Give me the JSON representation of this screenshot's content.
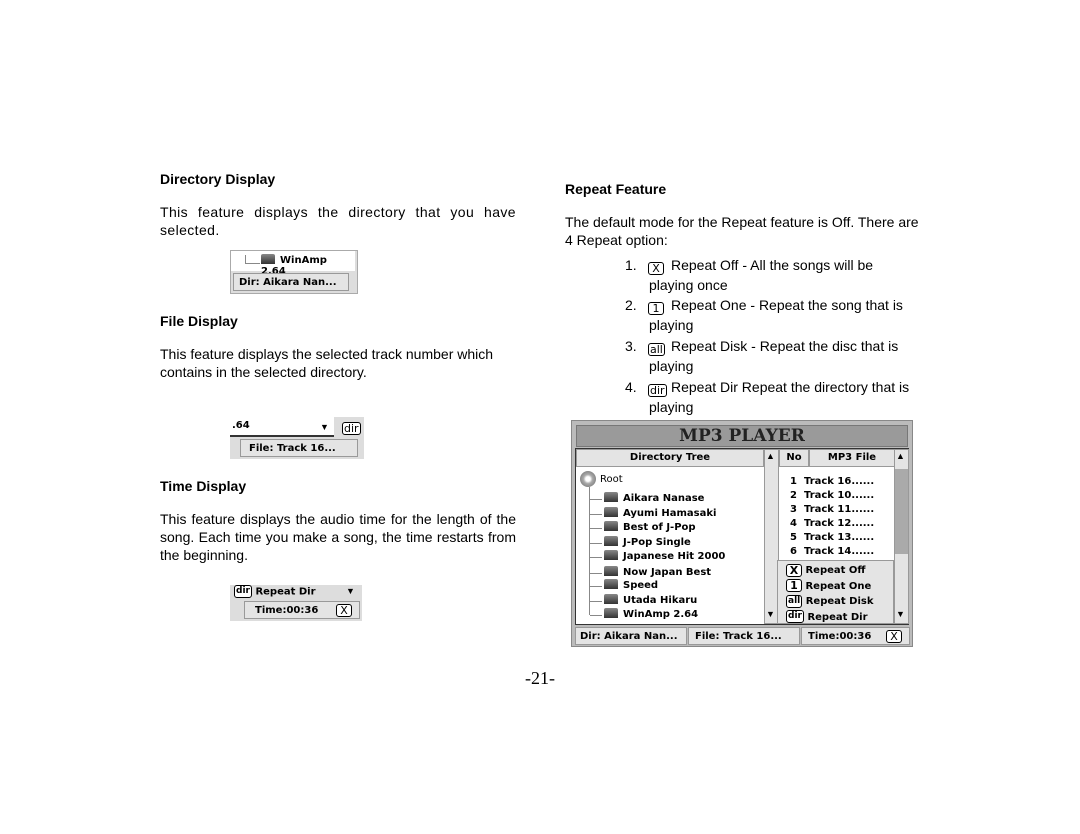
{
  "left": {
    "directory": {
      "heading": "Directory  Display",
      "text": "This feature displays the directory that you have selected.",
      "shot_item": "WinAmp 2.64",
      "shot_status": "Dir: Aikara Nan..."
    },
    "file": {
      "heading": "File  Display",
      "text": "This feature displays the selected track number which contains in  the selected directory.",
      "shot_item": ".64",
      "shot_icon": "dir",
      "shot_status": "File: Track 16..."
    },
    "time": {
      "heading": "Time Display",
      "text": "This feature displays the audio time for the length of the song.  Each time you make a song, the time restarts from the beginning.",
      "shot_item": "Repeat Dir",
      "shot_icon": "dir",
      "shot_status": "Time:00:36",
      "shot_status_icon": "X"
    }
  },
  "right": {
    "heading": "Repeat  Feature",
    "intro": "The default mode for the Repeat feature is Off. There are 4 Repeat option:",
    "options": [
      {
        "num": "1.",
        "icon": "X",
        "text": "Repeat Off -  All the songs will be playing once"
      },
      {
        "num": "2.",
        "icon": "1",
        "text": "Repeat One - Repeat the song that is playing"
      },
      {
        "num": "3.",
        "icon": "all",
        "text": "Repeat Disk - Repeat the disc that is playing"
      },
      {
        "num": "4.",
        "icon": "dir",
        "text": "Repeat Dir  Repeat the directory that is playing"
      }
    ]
  },
  "player": {
    "title": "MP3 PLAYER",
    "dir_header": "Directory Tree",
    "no_header": "No",
    "file_header": "MP3 File",
    "root": "Root",
    "folders": [
      "Aikara Nanase",
      "Ayumi Hamasaki",
      "Best of J-Pop",
      "J-Pop Single",
      "Japanese Hit 2000",
      "Now Japan Best",
      "Speed",
      "Utada Hikaru",
      "WinAmp 2.64"
    ],
    "tracks": [
      {
        "no": "1",
        "name": "Track 16......"
      },
      {
        "no": "2",
        "name": "Track 10......"
      },
      {
        "no": "3",
        "name": "Track 11......"
      },
      {
        "no": "4",
        "name": "Track 12......"
      },
      {
        "no": "5",
        "name": "Track 13......"
      },
      {
        "no": "6",
        "name": "Track 14......"
      }
    ],
    "repeat_menu": [
      {
        "icon": "X",
        "label": "Repeat Off"
      },
      {
        "icon": "1",
        "label": "Repeat One"
      },
      {
        "icon": "all",
        "label": "Repeat Disk"
      },
      {
        "icon": "dir",
        "label": "Repeat Dir"
      }
    ],
    "status": {
      "dir": "Dir: Aikara Nan...",
      "file": "File: Track 16...",
      "time": "Time:00:36",
      "repeat_icon": "X"
    }
  },
  "page_number": "-21-"
}
